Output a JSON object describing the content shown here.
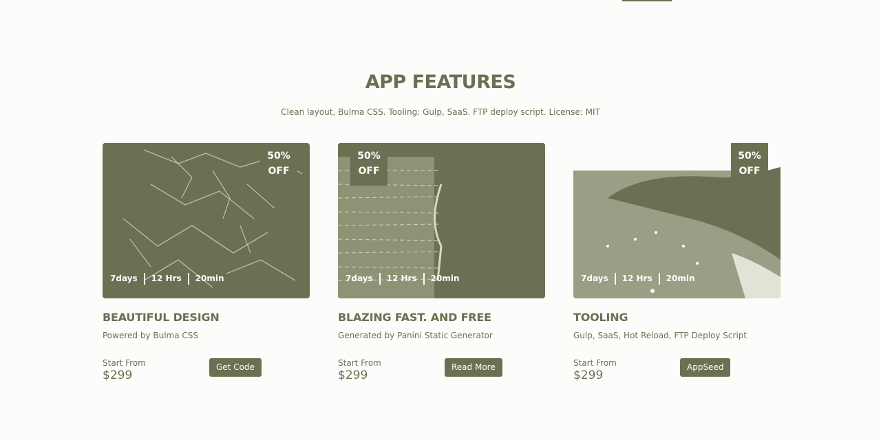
{
  "section": {
    "title": "APP FEATURES",
    "subtitle": "Clean layout, Bulma CSS. Tooling: Gulp, SaaS. FTP deploy script. License: MIT"
  },
  "colors": {
    "accent": "#6b7052",
    "background": "#fcfcfa"
  },
  "cards": [
    {
      "badge_line1": "50%",
      "badge_line2": "OFF",
      "meta": [
        "7days",
        "12 Hrs",
        "20min"
      ],
      "title": "BEAUTIFUL DESIGN",
      "description": "Powered by Bulma CSS",
      "start_label": "Start From",
      "price": "$299",
      "button_label": "Get Code"
    },
    {
      "badge_line1": "50%",
      "badge_line2": "OFF",
      "meta": [
        "7days",
        "12 Hrs",
        "20min"
      ],
      "title": "BLAZING FAST. AND FREE",
      "description": "Generated by Panini Static Generator",
      "start_label": "Start From",
      "price": "$299",
      "button_label": "Read More"
    },
    {
      "badge_line1": "50%",
      "badge_line2": "OFF",
      "meta": [
        "7days",
        "12 Hrs",
        "20min"
      ],
      "title": "TOOLING",
      "description": "Gulp, SaaS, Hot Reload, FTP Deploy Script",
      "start_label": "Start From",
      "price": "$299",
      "button_label": "AppSeed"
    }
  ]
}
